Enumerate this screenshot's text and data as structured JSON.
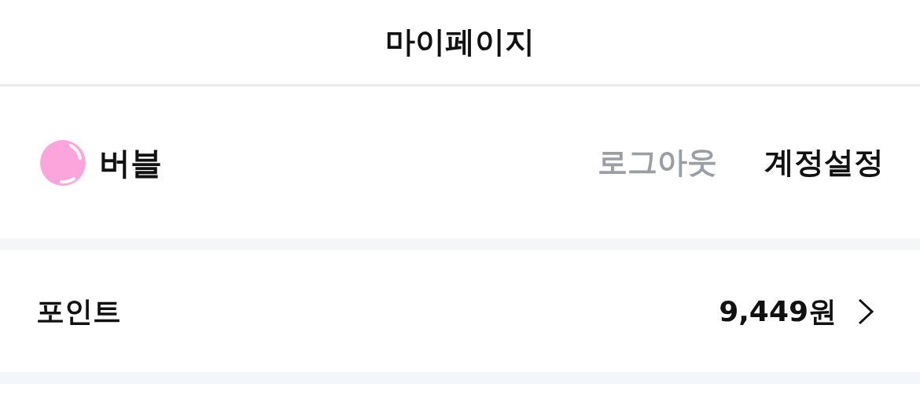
{
  "header": {
    "title": "마이페이지"
  },
  "profile": {
    "name": "버블",
    "actions": [
      {
        "label": "로그아웃",
        "kind": "secondary"
      },
      {
        "label": "계정설정",
        "kind": "primary"
      }
    ]
  },
  "menu": [
    {
      "label": "포인트",
      "value": "9,449원"
    }
  ]
}
